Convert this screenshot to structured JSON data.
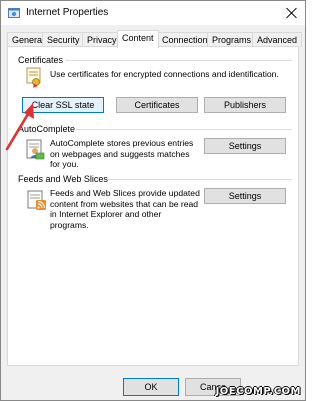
{
  "window": {
    "title": "Internet Properties",
    "title_icon": "internet-options-icon",
    "close_icon": "close-icon"
  },
  "tabs": [
    {
      "label": "General"
    },
    {
      "label": "Security"
    },
    {
      "label": "Privacy"
    },
    {
      "label": "Content"
    },
    {
      "label": "Connections"
    },
    {
      "label": "Programs"
    },
    {
      "label": "Advanced"
    }
  ],
  "active_tab": "Content",
  "certificates": {
    "heading": "Certificates",
    "description": "Use certificates for encrypted connections and identification.",
    "icon": "certificate-icon",
    "clear_ssl_label": "Clear SSL state",
    "certificates_label": "Certificates",
    "publishers_label": "Publishers"
  },
  "autocomplete": {
    "heading": "AutoComplete",
    "description": "AutoComplete stores previous entries on webpages and suggests matches for you.",
    "icon": "autocomplete-icon",
    "settings_label": "Settings"
  },
  "feeds": {
    "heading": "Feeds and Web Slices",
    "description": "Feeds and Web Slices provide updated content from websites that can be read in Internet Explorer and other programs.",
    "icon": "rss-feed-icon",
    "settings_label": "Settings"
  },
  "footer": {
    "ok_label": "OK",
    "cancel_label": "Cance"
  },
  "annotation": {
    "arrow_color": "#e0322e"
  },
  "watermark": "JOECOMP.COM"
}
